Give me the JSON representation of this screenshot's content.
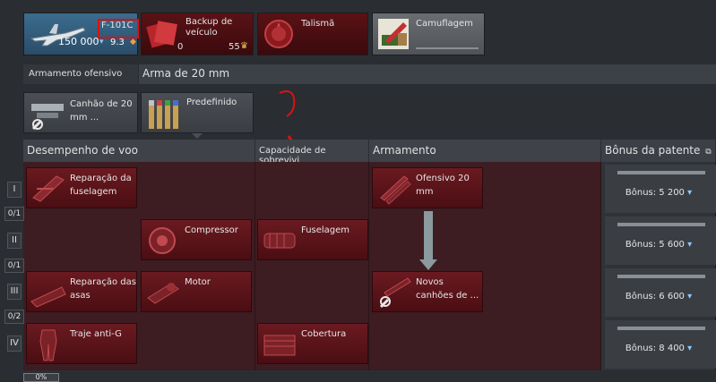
{
  "top_cards": {
    "aircraft": {
      "name": "F-101C",
      "lions": "150 000",
      "rank": "9.3"
    },
    "backup": {
      "label": "Backup de veículo",
      "count": "0",
      "cost": "55"
    },
    "talisma": {
      "label": "Talismã"
    },
    "camo": {
      "label": "Camuflagem"
    }
  },
  "tabs": {
    "offensive_armament": "Armamento ofensivo",
    "weapon_title": "Arma de 20 mm"
  },
  "weapon_cards": {
    "cannon": "Canhão de 20 mm ...",
    "preset": "Predefinido"
  },
  "columns": {
    "flight": "Desempenho de voo",
    "survivability": "Capacidade de sobrevivi",
    "armament": "Armamento",
    "rank_bonus": "Bônus da patente"
  },
  "ranks": [
    {
      "numeral": "I",
      "count": "0/1"
    },
    {
      "numeral": "II",
      "count": "0/1"
    },
    {
      "numeral": "III",
      "count": "0/2"
    },
    {
      "numeral": "IV"
    }
  ],
  "mods": {
    "fuselage_repair": "Reparação da fuselagem",
    "compressor": "Compressor",
    "fuselage": "Fuselagem",
    "offensive_20mm": "Ofensivo 20 mm",
    "wing_repair": "Reparação das asas",
    "engine": "Motor",
    "new_cannons": "Novos canhões de ...",
    "anti_g": "Traje anti-G",
    "cover": "Cobertura"
  },
  "bonuses": [
    "Bônus: 5 200",
    "Bônus: 5 600",
    "Bônus: 6 600",
    "Bônus: 8 400"
  ],
  "footer": {
    "percent": "0%"
  },
  "colors": {
    "accent_red": "#e01010",
    "mod_bg": "#5a1419",
    "panel_bg": "#3d1c22"
  }
}
